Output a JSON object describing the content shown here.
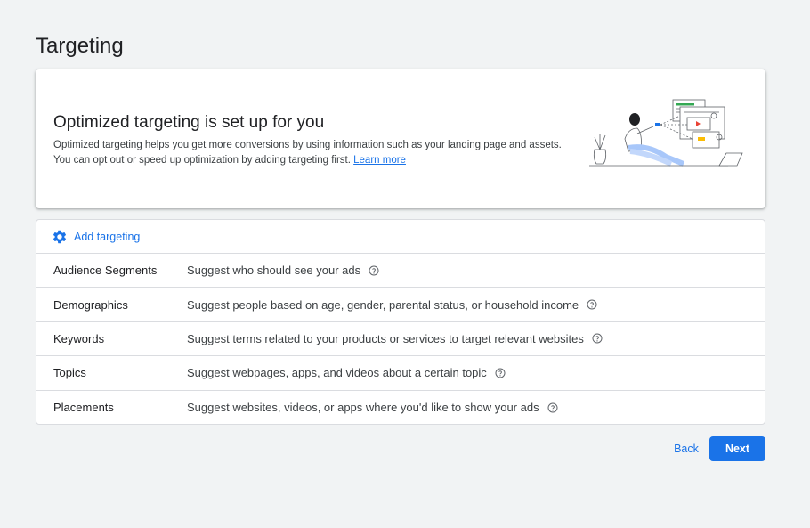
{
  "page": {
    "title": "Targeting"
  },
  "banner": {
    "title": "Optimized targeting is set up for you",
    "description_line1": "Optimized targeting helps you get more conversions by using information such as your landing page and assets.",
    "description_line2": "You can opt out or speed up optimization by adding targeting first.",
    "learn_more": "Learn more"
  },
  "targeting": {
    "add_label": "Add targeting",
    "rows": [
      {
        "name": "Audience Segments",
        "description": "Suggest who should see your ads"
      },
      {
        "name": "Demographics",
        "description": "Suggest people based on age, gender, parental status, or household income"
      },
      {
        "name": "Keywords",
        "description": "Suggest terms related to your products or services to target relevant websites"
      },
      {
        "name": "Topics",
        "description": "Suggest webpages, apps, and videos about a certain topic"
      },
      {
        "name": "Placements",
        "description": "Suggest websites, videos, or apps where you'd like to show your ads"
      }
    ]
  },
  "footer": {
    "back_label": "Back",
    "next_label": "Next"
  },
  "colors": {
    "accent": "#1a73e8",
    "background": "#f1f3f4"
  },
  "icons": {
    "add_targeting": "gear-icon",
    "row_help": "help-icon"
  }
}
